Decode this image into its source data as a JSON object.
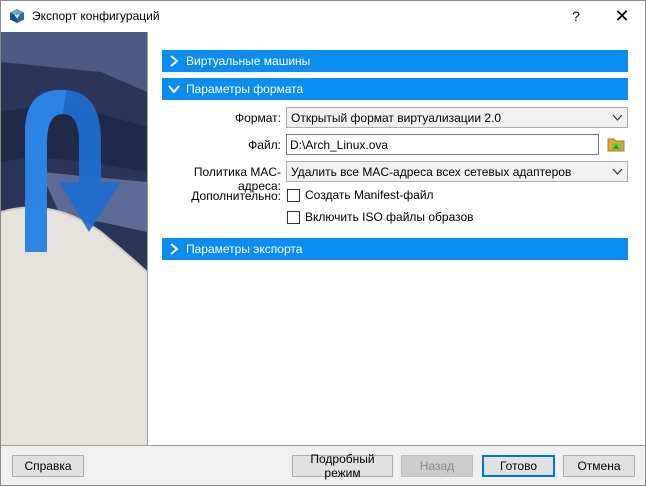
{
  "window": {
    "title": "Экспорт конфигураций",
    "help_glyph": "?",
    "close_glyph": "✕"
  },
  "sections": {
    "vms": {
      "label": "Виртуальные машины",
      "expanded": false
    },
    "format": {
      "label": "Параметры формата",
      "expanded": true
    },
    "export": {
      "label": "Параметры экспорта",
      "expanded": false
    }
  },
  "form": {
    "format_label": "Формат:",
    "format_value": "Открытый формат виртуализации 2.0",
    "file_label": "Файл:",
    "file_value": "D:\\Arch_Linux.ova",
    "mac_label": "Политика MAC-адреса:",
    "mac_value": "Удалить все MAC-адреса всех сетевых адаптеров",
    "extra_label": "Дополнительно:",
    "manifest_label": "Создать Manifest-файл",
    "manifest_checked": false,
    "iso_label": "Включить ISO файлы образов",
    "iso_checked": false
  },
  "buttons": {
    "help": "Справка",
    "expert": "Подробный режим",
    "back": "Назад",
    "finish": "Готово",
    "cancel": "Отмена"
  },
  "colors": {
    "accent": "#0b8cf0",
    "default_border": "#0078d7"
  }
}
